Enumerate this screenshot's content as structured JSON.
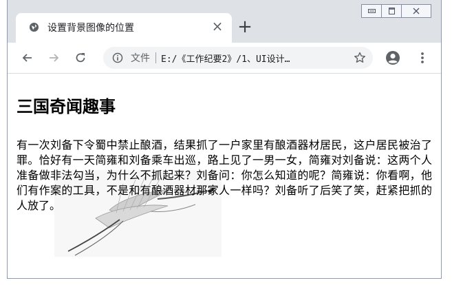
{
  "browser": {
    "tab_title": "设置背景图像的位置",
    "tab_close": "×",
    "new_tab": "+",
    "address_label": "文件",
    "address_url": "E:/《工作纪要2》/1、UI设计…"
  },
  "page": {
    "heading": "三国奇闻趣事",
    "paragraph": "有一次刘备下令蜀中禁止酿酒，结果抓了一户家里有酿酒器材居民，这户居民被治了罪。恰好有一天简雍和刘备乘车出巡，路上见了一男一女，简雍对刘备说：这两个人准备做非法勾当，为什么不抓起来？刘备问：你怎么知道的呢？简雍说：你看啊，他们有作案的工具，不是和有酿酒器材那家人一样吗？刘备听了后笑了笑，赶紧把抓的人放了。"
  },
  "icons": {
    "favicon": "globe-icon",
    "back": "back-arrow-icon",
    "forward": "forward-arrow-icon",
    "reload": "reload-icon",
    "info": "info-icon",
    "bookmark": "star-icon",
    "account": "account-icon",
    "menu": "kebab-menu-icon",
    "background_image": "crane-icon"
  },
  "colors": {
    "titlebar": "#dee1e6",
    "omnibox": "#f1f3f4",
    "icon": "#5f6368"
  }
}
